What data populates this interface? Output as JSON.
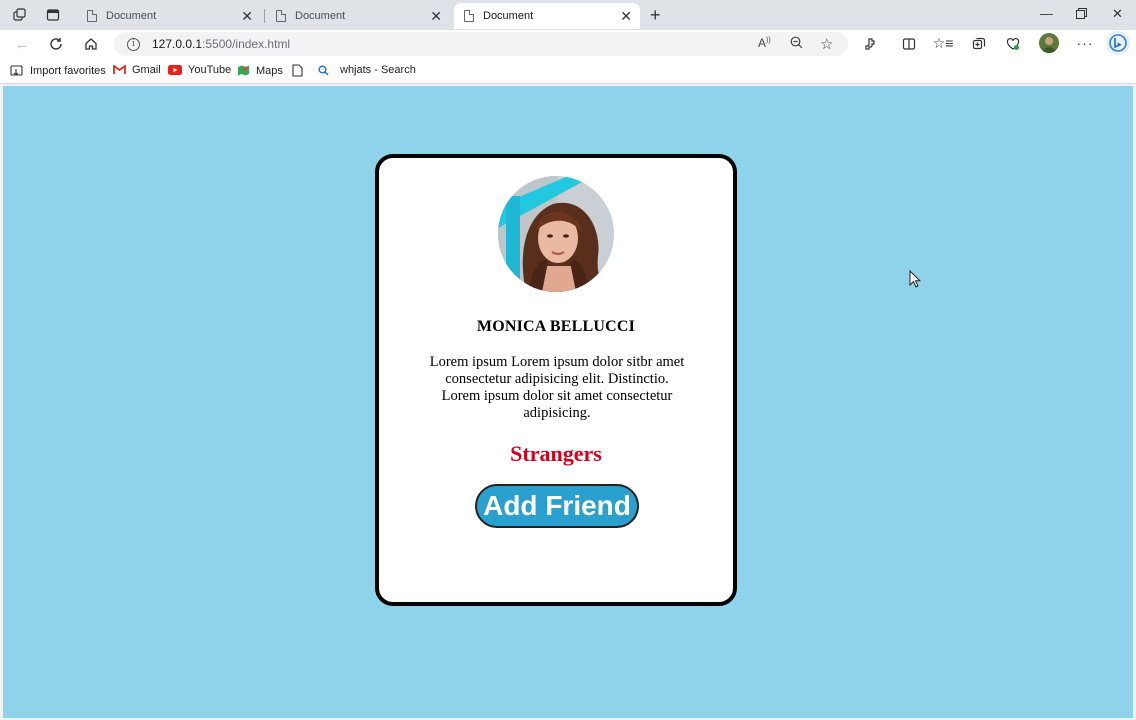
{
  "browser": {
    "tabs": [
      {
        "label": "Document",
        "active": false
      },
      {
        "label": "Document",
        "active": false
      },
      {
        "label": "Document",
        "active": true
      }
    ],
    "url_host": "127.0.0.1",
    "url_rest": ":5500/index.html",
    "bookmarks": [
      {
        "label": "Import favorites",
        "icon": "import-icon"
      },
      {
        "label": "Gmail",
        "icon": "gmail-icon"
      },
      {
        "label": "YouTube",
        "icon": "youtube-icon"
      },
      {
        "label": "Maps",
        "icon": "maps-icon"
      },
      {
        "label": "",
        "icon": "document-icon"
      },
      {
        "label": "whjats - Search",
        "icon": "search-icon"
      }
    ]
  },
  "card": {
    "name": "MONICA BELLUCCI",
    "bio": "Lorem ipsum Lorem ipsum dolor sitbr amet consectetur adipisicing elit. Distinctio. Lorem ipsum dolor sit amet consectetur adipisicing.",
    "status": "Strangers",
    "button_label": "Add Friend"
  },
  "colors": {
    "page_background": "#8fd3ea",
    "status_text": "#d6001c",
    "button_background": "#2aa0cf"
  }
}
